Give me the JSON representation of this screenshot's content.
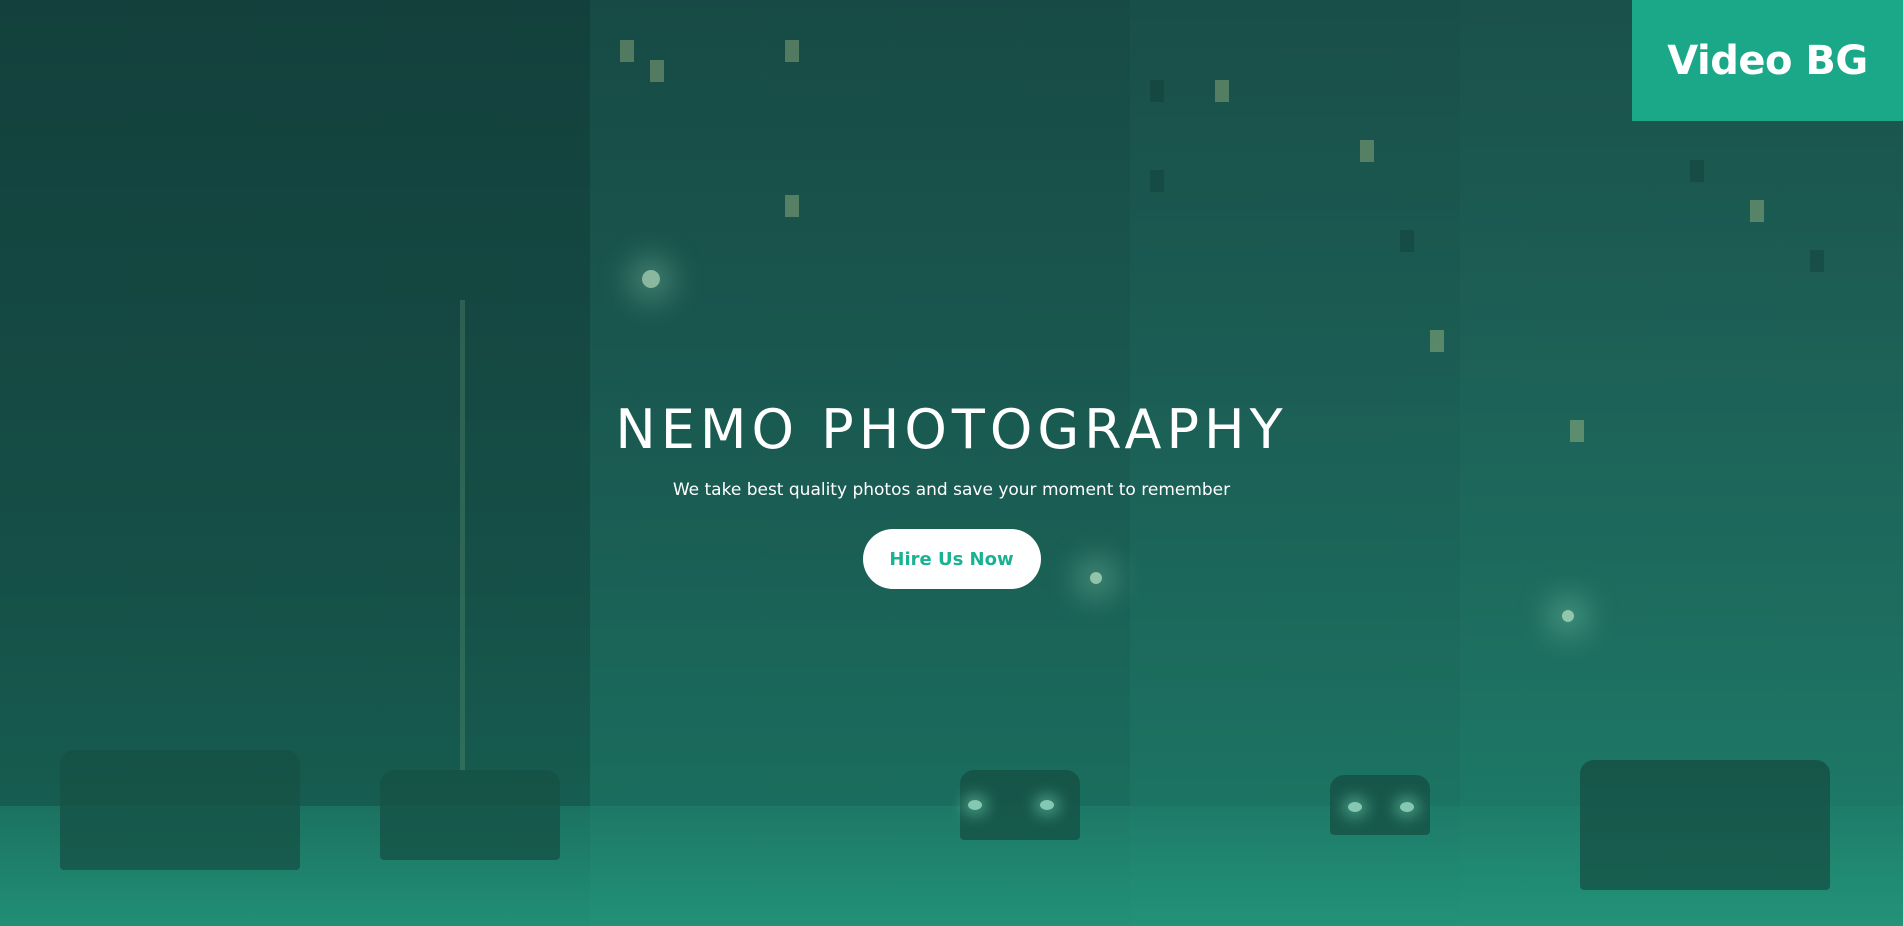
{
  "badge": {
    "label": "Video BG"
  },
  "hero": {
    "title": "NEMO PHOTOGRAPHY",
    "subtitle": "We take best quality photos and save your moment to remember",
    "cta_label": "Hire Us Now"
  },
  "colors": {
    "accent": "#1aa889",
    "cta_text": "#1bb293",
    "overlay": "#1f8a75"
  }
}
